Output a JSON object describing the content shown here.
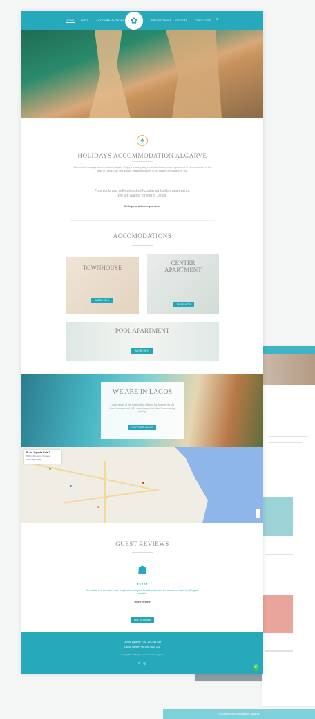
{
  "nav": {
    "items": [
      "HOME",
      "INFO",
      "ACCOMMODATIONS",
      "PROMOTIONS",
      "OFFERS",
      "CONTACTS"
    ],
    "search_icon": "search-icon",
    "logo_icon": "palm-tree-icon"
  },
  "intro": {
    "title": "HOLIDAYS ACCOMMODATION ALGARVE",
    "body": "Welcome to Holidays Accommodation Algarve. Enjoy a relaxing stay in our townhouse, center apartment or pool apartment in the heart of Lagos. Sun, sea and the beautiful beaches of the Algarve are waiting for you.",
    "quote_line1": "Pure pools and self-catered self-contained holiday apartments.",
    "quote_line2": "We are waiting for you in Lagos.",
    "signature": "We hope to welcome you soon!"
  },
  "accommodations": {
    "heading": "ACCOMODATIONS",
    "cards": [
      {
        "title": "TOWNHOUSE",
        "button": "MORE INFO"
      },
      {
        "title": "CENTER APARTMENT",
        "button": "MORE INFO"
      },
      {
        "title": "POOL APARTMENT",
        "button": "MORE INFO"
      }
    ]
  },
  "lagos": {
    "title": "WE ARE IN LAGOS",
    "body": "Lagos is one of the most visited cities in the Algarve. Its old town, beaches and cliffs make it a perfect place for a relaxing holiday.",
    "button": "DISCOVER LAGOS"
  },
  "map": {
    "place_name": "R. do Jogo da Bola 7",
    "address": "8600-630 Lagos, Portugal",
    "link": "View larger map"
  },
  "reviews": {
    "heading": "GUEST REVIEWS",
    "stars_label": "★★★★★",
    "quote": "Very clean and the owner was very kind and helpful. Great location and the apartment had everything we needed.",
    "author": "Guest Review",
    "button": "SEE REVIEWS"
  },
  "footer": {
    "phone1": "Central Algarve: +351 123 456 789",
    "phone2": "Lagos Centre: +351 987 654 321",
    "copyright": "Copyright © Holidays Accommodation Algarve",
    "social": [
      "facebook-icon",
      "instagram-icon"
    ]
  },
  "colors": {
    "brand": "#26a9ba",
    "button": "#24a6b8",
    "whatsapp": "#3ec45a"
  },
  "bg_footer_text": "Holidays Accommodation Algarve"
}
